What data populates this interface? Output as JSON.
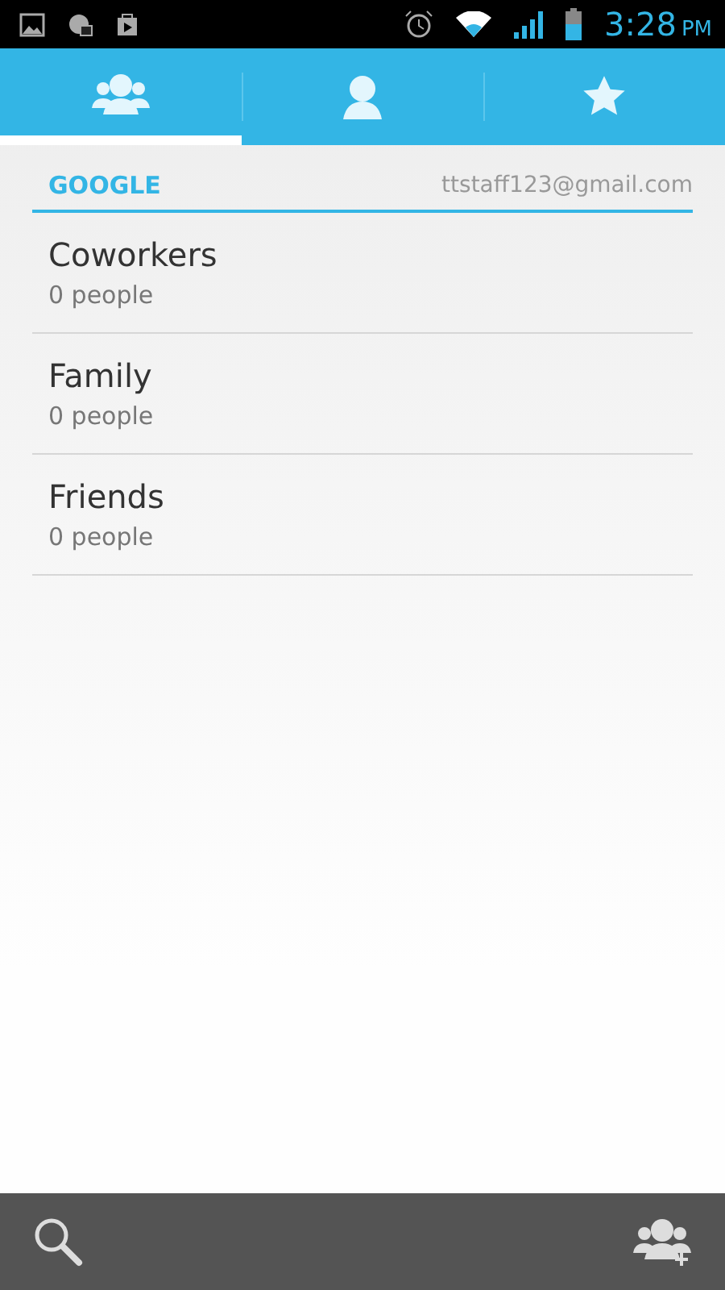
{
  "status_bar": {
    "time": "3:28",
    "ampm": "PM"
  },
  "tabs": [
    {
      "kind": "groups",
      "selected": true
    },
    {
      "kind": "person",
      "selected": false
    },
    {
      "kind": "star",
      "selected": false
    }
  ],
  "account": {
    "type": "GOOGLE",
    "email": "ttstaff123@gmail.com"
  },
  "groups": [
    {
      "name": "Coworkers",
      "count": "0 people"
    },
    {
      "name": "Family",
      "count": "0 people"
    },
    {
      "name": "Friends",
      "count": "0 people"
    }
  ]
}
